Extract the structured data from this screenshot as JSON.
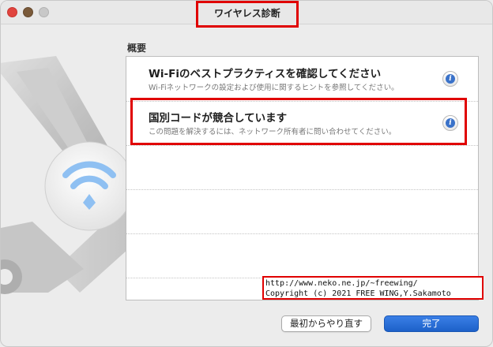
{
  "window": {
    "title": "ワイヤレス診断"
  },
  "summary": {
    "label": "概要",
    "items": [
      {
        "title": "Wi-Fiのベストプラクティスを確認してください",
        "subtitle": "Wi-Fiネットワークの設定および使用に関するヒントを参照してください。",
        "info_icon": "info-icon"
      },
      {
        "title": "国別コードが競合しています",
        "subtitle": "この問題を解決するには、ネットワーク所有者に問い合わせてください。",
        "info_icon": "info-icon"
      }
    ]
  },
  "overlay": {
    "url": "http://www.neko.ne.jp/~freewing/",
    "copyright": "Copyright (c) 2021 FREE WING,Y.Sakamoto"
  },
  "buttons": {
    "restart": "最初からやり直す",
    "done": "完了"
  },
  "colors": {
    "accent": "#1d61c9",
    "highlight": "#e00000",
    "wifi": "#8fc0f2"
  }
}
